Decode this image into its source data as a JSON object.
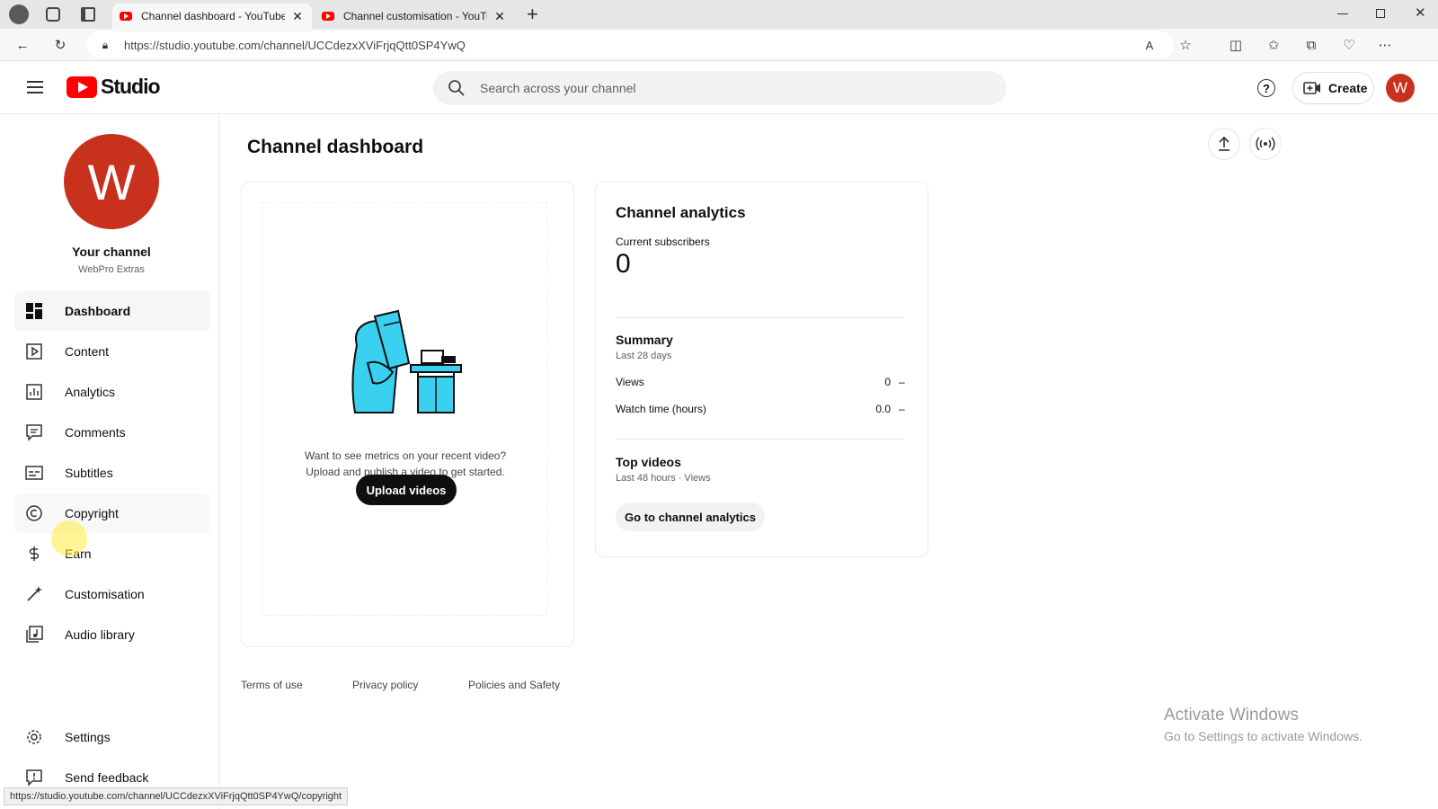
{
  "browser": {
    "tabs": [
      {
        "label": "Channel dashboard - YouTube St",
        "active": true
      },
      {
        "label": "Channel customisation - YouTube",
        "active": false
      }
    ],
    "new_tab": "+",
    "url": "https://studio.youtube.com/channel/UCCdezxXViFrjqQtt0SP4YwQ",
    "window_controls": [
      "minimize-icon",
      "restore-icon",
      "close-icon"
    ],
    "status_url": "https://studio.youtube.com/channel/UCCdezxXViFrjqQtt0SP4YwQ/copyright"
  },
  "header": {
    "logo_text": "Studio",
    "search_placeholder": "Search across your channel",
    "create_label": "Create",
    "avatar_letter": "W"
  },
  "sidebar": {
    "avatar_letter": "W",
    "channel_title": "Your channel",
    "channel_name": "WebPro Extras",
    "items": [
      {
        "label": "Dashboard",
        "icon": "dashboard-icon",
        "active": true
      },
      {
        "label": "Content",
        "icon": "content-icon"
      },
      {
        "label": "Analytics",
        "icon": "analytics-icon"
      },
      {
        "label": "Comments",
        "icon": "comments-icon"
      },
      {
        "label": "Subtitles",
        "icon": "subtitles-icon"
      },
      {
        "label": "Copyright",
        "icon": "copyright-icon",
        "hovered": true
      },
      {
        "label": "Earn",
        "icon": "dollar-icon"
      },
      {
        "label": "Customisation",
        "icon": "wand-icon"
      },
      {
        "label": "Audio library",
        "icon": "audio-library-icon"
      }
    ],
    "bottom_items": [
      {
        "label": "Settings",
        "icon": "gear-icon"
      },
      {
        "label": "Send feedback",
        "icon": "feedback-icon"
      }
    ]
  },
  "main": {
    "title": "Channel dashboard",
    "upload_card": {
      "line1": "Want to see metrics on your recent video?",
      "line2": "Upload and publish a video to get started.",
      "button": "Upload videos"
    },
    "analytics_card": {
      "title": "Channel analytics",
      "subscribers_label": "Current subscribers",
      "subscribers_value": "0",
      "summary_title": "Summary",
      "summary_period": "Last 28 days",
      "rows": [
        {
          "label": "Views",
          "value": "0",
          "trend": "–"
        },
        {
          "label": "Watch time (hours)",
          "value": "0.0",
          "trend": "–"
        }
      ],
      "top_videos_title": "Top videos",
      "top_videos_period": "Last 48 hours · Views",
      "button": "Go to channel analytics"
    },
    "footer": [
      "Terms of use",
      "Privacy policy",
      "Policies and Safety"
    ]
  },
  "watermark": {
    "line1": "Activate Windows",
    "line2": "Go to Settings to activate Windows."
  },
  "colors": {
    "brand_red": "#ff0000",
    "avatar": "#c8321d",
    "illustration": "#3ad0f0"
  }
}
